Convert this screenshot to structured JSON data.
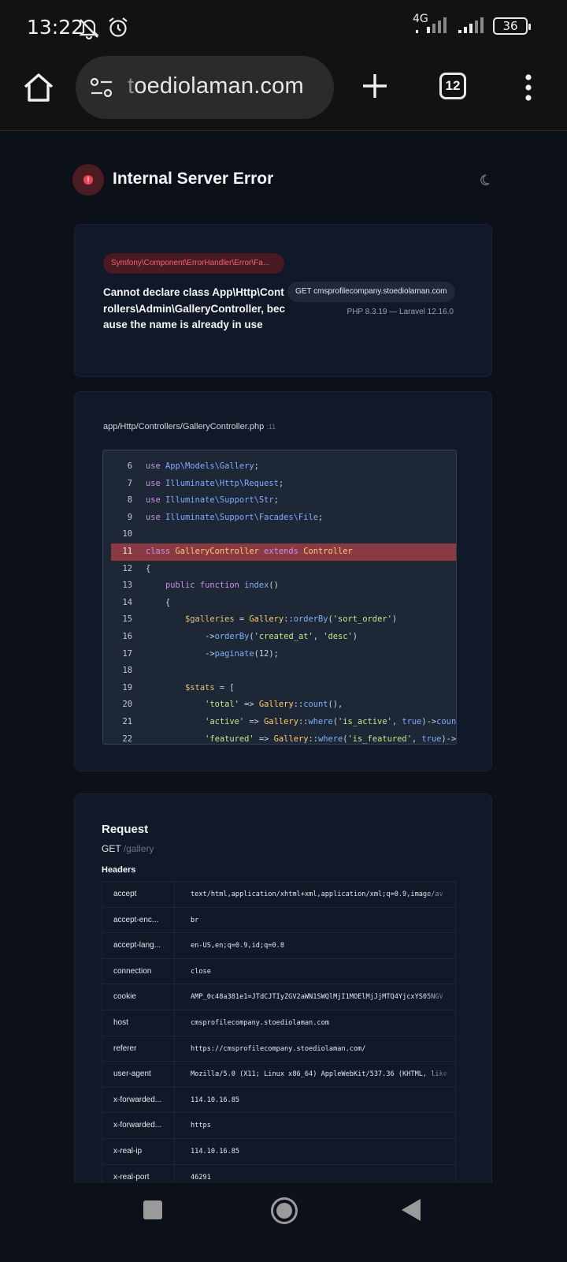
{
  "status_bar": {
    "time": "13:22",
    "network": "4G",
    "battery": "36",
    "icons": [
      "mute-notifications-icon",
      "alarm-icon",
      "signal-icon",
      "battery-icon"
    ]
  },
  "browser": {
    "url_faded": "t",
    "url_rest": "oediolaman.com",
    "tab_count": "12",
    "icons": [
      "home-icon",
      "site-settings-icon",
      "plus-icon",
      "tabs-icon",
      "more-vert-icon"
    ]
  },
  "error": {
    "title": "Internal Server Error",
    "exception_class": "Symfony\\Component\\ErrorHandler\\Error\\Fa...",
    "message": "Cannot declare class App\\Http\\Controllers\\Admin\\GalleryController, because the name is already in use",
    "request_pill": "GET cmsprofilecompany.stoediolaman.com",
    "versions": "PHP 8.3.19 — Laravel 12.16.0"
  },
  "source": {
    "file": "app/Http/Controllers/GalleryController.php",
    "line_label": ":11",
    "highlight_line": 11,
    "lines": [
      {
        "n": "6",
        "segs": [
          [
            "k",
            "use "
          ],
          [
            "c",
            "App\\Models\\Gallery"
          ],
          [
            "p",
            ";"
          ]
        ]
      },
      {
        "n": "7",
        "segs": [
          [
            "k",
            "use "
          ],
          [
            "c",
            "Illuminate\\Http\\Request"
          ],
          [
            "p",
            ";"
          ]
        ]
      },
      {
        "n": "8",
        "segs": [
          [
            "k",
            "use "
          ],
          [
            "c",
            "Illuminate\\Support\\Str"
          ],
          [
            "p",
            ";"
          ]
        ]
      },
      {
        "n": "9",
        "segs": [
          [
            "k",
            "use "
          ],
          [
            "c",
            "Illuminate\\Support\\Facades\\File"
          ],
          [
            "p",
            ";"
          ]
        ]
      },
      {
        "n": "10",
        "segs": []
      },
      {
        "n": "11",
        "segs": [
          [
            "kw",
            "class "
          ],
          [
            "cls",
            "GalleryController "
          ],
          [
            "kw",
            "extends "
          ],
          [
            "cls",
            "Controller"
          ]
        ]
      },
      {
        "n": "12",
        "segs": [
          [
            "p",
            "{"
          ]
        ]
      },
      {
        "n": "13",
        "segs": [
          [
            "p",
            "    "
          ],
          [
            "kw",
            "public function "
          ],
          [
            "f",
            "index"
          ],
          [
            "p",
            "()"
          ]
        ]
      },
      {
        "n": "14",
        "segs": [
          [
            "p",
            "    {"
          ]
        ]
      },
      {
        "n": "15",
        "segs": [
          [
            "p",
            "        "
          ],
          [
            "v",
            "$galleries"
          ],
          [
            "p",
            " = "
          ],
          [
            "cls",
            "Gallery"
          ],
          [
            "p",
            "::"
          ],
          [
            "f",
            "orderBy"
          ],
          [
            "p",
            "("
          ],
          [
            "s",
            "'sort_order'"
          ],
          [
            "p",
            ")"
          ]
        ]
      },
      {
        "n": "16",
        "segs": [
          [
            "p",
            "            ->"
          ],
          [
            "f",
            "orderBy"
          ],
          [
            "p",
            "("
          ],
          [
            "s",
            "'created_at'"
          ],
          [
            "p",
            ", "
          ],
          [
            "s",
            "'desc'"
          ],
          [
            "p",
            ")"
          ]
        ]
      },
      {
        "n": "17",
        "segs": [
          [
            "p",
            "            ->"
          ],
          [
            "f",
            "paginate"
          ],
          [
            "p",
            "(12);"
          ]
        ]
      },
      {
        "n": "18",
        "segs": []
      },
      {
        "n": "19",
        "segs": [
          [
            "p",
            "        "
          ],
          [
            "v",
            "$stats"
          ],
          [
            "p",
            " = ["
          ]
        ]
      },
      {
        "n": "20",
        "segs": [
          [
            "p",
            "            "
          ],
          [
            "s",
            "'total'"
          ],
          [
            "p",
            " => "
          ],
          [
            "cls",
            "Gallery"
          ],
          [
            "p",
            "::"
          ],
          [
            "f",
            "count"
          ],
          [
            "p",
            "(),"
          ]
        ]
      },
      {
        "n": "21",
        "segs": [
          [
            "p",
            "            "
          ],
          [
            "s",
            "'active'"
          ],
          [
            "p",
            " => "
          ],
          [
            "cls",
            "Gallery"
          ],
          [
            "p",
            "::"
          ],
          [
            "f",
            "where"
          ],
          [
            "p",
            "("
          ],
          [
            "s",
            "'is_active'"
          ],
          [
            "p",
            ", "
          ],
          [
            "t",
            "true"
          ],
          [
            "p",
            ")->"
          ],
          [
            "f",
            "count"
          ],
          [
            "p",
            "("
          ]
        ]
      },
      {
        "n": "22",
        "segs": [
          [
            "p",
            "            "
          ],
          [
            "s",
            "'featured'"
          ],
          [
            "p",
            " => "
          ],
          [
            "cls",
            "Gallery"
          ],
          [
            "p",
            "::"
          ],
          [
            "f",
            "where"
          ],
          [
            "p",
            "("
          ],
          [
            "s",
            "'is_featured'"
          ],
          [
            "p",
            ", "
          ],
          [
            "t",
            "true"
          ],
          [
            "p",
            ")->"
          ],
          [
            "f",
            "co"
          ]
        ]
      }
    ]
  },
  "request": {
    "heading": "Request",
    "method": "GET",
    "path": "/gallery",
    "headers_heading": "Headers",
    "headers": [
      {
        "key": "accept",
        "value": "text/html,application/xhtml+xml,application/xml;q=0.9,image/av"
      },
      {
        "key": "accept-enc...",
        "value": "br"
      },
      {
        "key": "accept-lang...",
        "value": "en-US,en;q=0.9,id;q=0.8"
      },
      {
        "key": "connection",
        "value": "close"
      },
      {
        "key": "cookie",
        "value": "AMP_0c48a381e1=JTdCJTIyZGV2aWN1SWQlMjI1MOElMjJjMTQ4YjcxYS05NGV"
      },
      {
        "key": "host",
        "value": "cmsprofilecompany.stoediolaman.com"
      },
      {
        "key": "referer",
        "value": "https://cmsprofilecompany.stoediolaman.com/"
      },
      {
        "key": "user-agent",
        "value": "Mozilla/5.0 (X11; Linux x86_64) AppleWebKit/537.36 (KHTML, like"
      },
      {
        "key": "x-forwarded...",
        "value": "114.10.16.85"
      },
      {
        "key": "x-forwarded...",
        "value": "https"
      },
      {
        "key": "x-real-ip",
        "value": "114.10.16.85"
      },
      {
        "key": "x-real-port",
        "value": "46291"
      }
    ]
  },
  "nav_bar": {
    "icons": [
      "recents-square-icon",
      "home-circle-icon",
      "back-triangle-icon"
    ]
  }
}
